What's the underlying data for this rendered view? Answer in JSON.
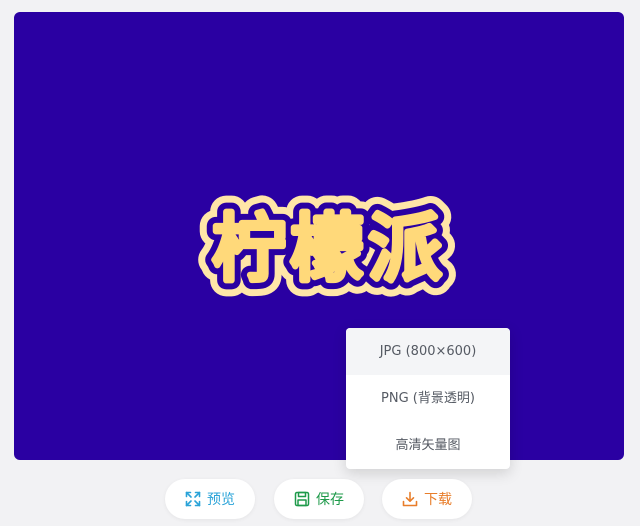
{
  "logo": {
    "text": "柠檬派",
    "fill_color": "#ffd97a",
    "outline_color": "#ffe6a8",
    "inner_outline_color": "#2a00a2"
  },
  "canvas": {
    "background": "#2a00a2"
  },
  "download_menu": {
    "items": [
      {
        "label": "JPG (800×600)"
      },
      {
        "label": "PNG (背景透明)"
      },
      {
        "label": "高清矢量图"
      }
    ]
  },
  "toolbar": {
    "preview": {
      "label": "预览",
      "icon": "expand-icon",
      "color": "#2aa3d8"
    },
    "save": {
      "label": "保存",
      "icon": "floppy-disk-icon",
      "color": "#1e9a4a"
    },
    "download": {
      "label": "下载",
      "icon": "download-icon",
      "color": "#e87d2a"
    }
  }
}
